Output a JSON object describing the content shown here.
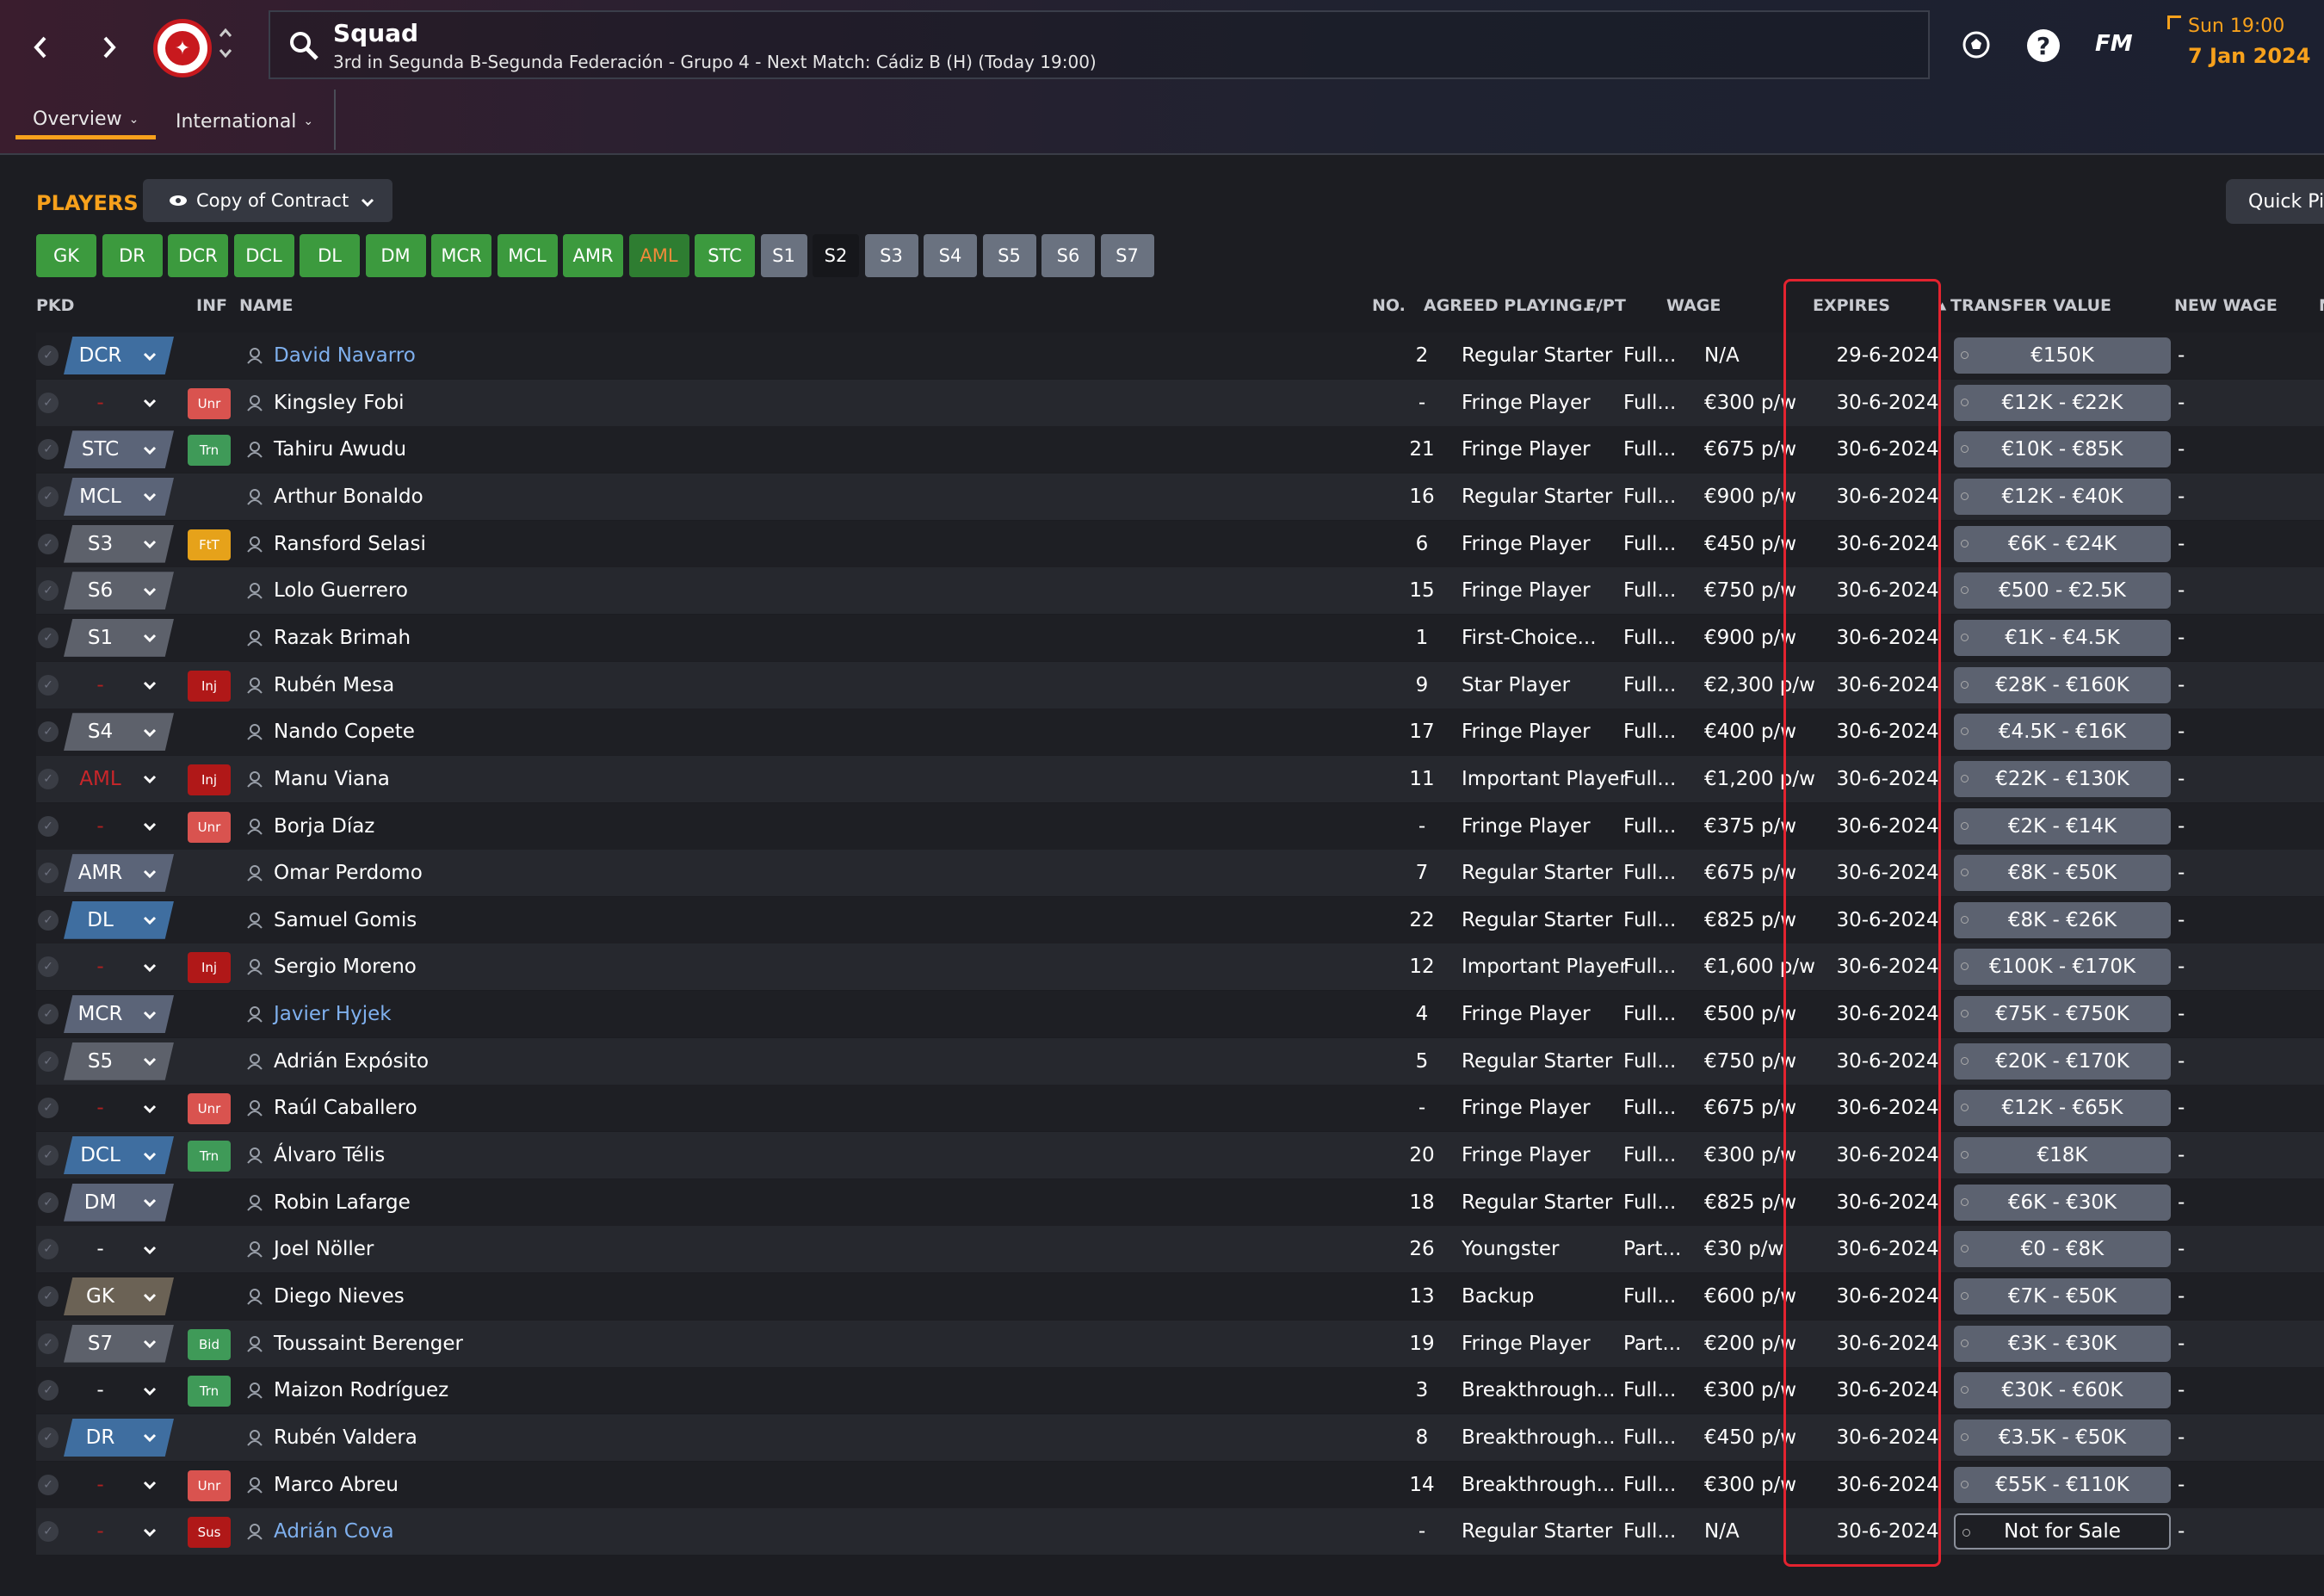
{
  "header": {
    "title": "Squad",
    "subtitle": "3rd in Segunda B-Segunda Federación - Grupo 4 - Next Match: Cádiz B (H) (Today 19:00)",
    "brand": "FM",
    "time": "Sun 19:00",
    "date": "7 Jan 2024",
    "help_symbol": "?"
  },
  "tabs": [
    {
      "label": "Overview",
      "active": true
    },
    {
      "label": "International",
      "active": false
    }
  ],
  "toolbar": {
    "section_label": "PLAYERS",
    "view_label": "Copy of Contract",
    "quick_pick_label": "Quick Pi"
  },
  "positions": [
    "GK",
    "DR",
    "DCR",
    "DCL",
    "DL",
    "DM",
    "MCR",
    "MCL",
    "AMR",
    "AML",
    "STC",
    "S1",
    "S2",
    "S3",
    "S4",
    "S5",
    "S6",
    "S7"
  ],
  "columns": {
    "pkd": "PKD",
    "inf": "INF",
    "name": "NAME",
    "no": "NO.",
    "agreed": "AGREED PLAYING...",
    "fpt": "F/PT",
    "wage": "WAGE",
    "expires": "EXPIRES",
    "transfer_value": "TRANSFER VALUE",
    "new_wage": "NEW WAGE",
    "extra": "N"
  },
  "colors": {
    "accent": "#f7a11c",
    "highlight_border": "#e3232f",
    "link": "#7fb0ee"
  },
  "players": [
    {
      "pos": "DCR",
      "inf": "",
      "name": "David Navarro",
      "no": "2",
      "agreed": "Regular Starter",
      "fpt": "Full...",
      "wage": "N/A",
      "expires": "29-6-2024",
      "tv": "€150K",
      "new_wage": "-"
    },
    {
      "pos": "-",
      "inf": "Unr",
      "name": "Kingsley Fobi",
      "no": "-",
      "agreed": "Fringe Player",
      "fpt": "Full...",
      "wage": "€300 p/w",
      "expires": "30-6-2024",
      "tv": "€12K - €22K",
      "new_wage": "-"
    },
    {
      "pos": "STC",
      "inf": "Trn",
      "name": "Tahiru Awudu",
      "no": "21",
      "agreed": "Fringe Player",
      "fpt": "Full...",
      "wage": "€675 p/w",
      "expires": "30-6-2024",
      "tv": "€10K - €85K",
      "new_wage": "-"
    },
    {
      "pos": "MCL",
      "inf": "",
      "name": "Arthur Bonaldo",
      "no": "16",
      "agreed": "Regular Starter",
      "fpt": "Full...",
      "wage": "€900 p/w",
      "expires": "30-6-2024",
      "tv": "€12K - €40K",
      "new_wage": "-"
    },
    {
      "pos": "S3",
      "inf": "FtT",
      "name": "Ransford Selasi",
      "no": "6",
      "agreed": "Fringe Player",
      "fpt": "Full...",
      "wage": "€450 p/w",
      "expires": "30-6-2024",
      "tv": "€6K - €24K",
      "new_wage": "-"
    },
    {
      "pos": "S6",
      "inf": "",
      "name": "Lolo Guerrero",
      "no": "15",
      "agreed": "Fringe Player",
      "fpt": "Full...",
      "wage": "€750 p/w",
      "expires": "30-6-2024",
      "tv": "€500 - €2.5K",
      "new_wage": "-"
    },
    {
      "pos": "S1",
      "inf": "",
      "name": "Razak Brimah",
      "no": "1",
      "agreed": "First-Choice...",
      "fpt": "Full...",
      "wage": "€900 p/w",
      "expires": "30-6-2024",
      "tv": "€1K - €4.5K",
      "new_wage": "-"
    },
    {
      "pos": "-",
      "inf": "Inj",
      "name": "Rubén Mesa",
      "no": "9",
      "agreed": "Star Player",
      "fpt": "Full...",
      "wage": "€2,300 p/w",
      "expires": "30-6-2024",
      "tv": "€28K - €160K",
      "new_wage": "-"
    },
    {
      "pos": "S4",
      "inf": "",
      "name": "Nando Copete",
      "no": "17",
      "agreed": "Fringe Player",
      "fpt": "Full...",
      "wage": "€400 p/w",
      "expires": "30-6-2024",
      "tv": "€4.5K - €16K",
      "new_wage": "-"
    },
    {
      "pos": "AML",
      "inf": "Inj",
      "name": "Manu Viana",
      "no": "11",
      "agreed": "Important Player",
      "fpt": "Full...",
      "wage": "€1,200 p/w",
      "expires": "30-6-2024",
      "tv": "€22K - €130K",
      "new_wage": "-"
    },
    {
      "pos": "-",
      "inf": "Unr",
      "name": "Borja Díaz",
      "no": "-",
      "agreed": "Fringe Player",
      "fpt": "Full...",
      "wage": "€375 p/w",
      "expires": "30-6-2024",
      "tv": "€2K - €14K",
      "new_wage": "-"
    },
    {
      "pos": "AMR",
      "inf": "",
      "name": "Omar Perdomo",
      "no": "7",
      "agreed": "Regular Starter",
      "fpt": "Full...",
      "wage": "€675 p/w",
      "expires": "30-6-2024",
      "tv": "€8K - €50K",
      "new_wage": "-"
    },
    {
      "pos": "DL",
      "inf": "",
      "name": "Samuel Gomis",
      "no": "22",
      "agreed": "Regular Starter",
      "fpt": "Full...",
      "wage": "€825 p/w",
      "expires": "30-6-2024",
      "tv": "€8K - €26K",
      "new_wage": "-"
    },
    {
      "pos": "-",
      "inf": "Inj",
      "name": "Sergio Moreno",
      "no": "12",
      "agreed": "Important Player",
      "fpt": "Full...",
      "wage": "€1,600 p/w",
      "expires": "30-6-2024",
      "tv": "€100K - €170K",
      "new_wage": "-"
    },
    {
      "pos": "MCR",
      "inf": "",
      "name": "Javier Hyjek",
      "no": "4",
      "agreed": "Fringe Player",
      "fpt": "Full...",
      "wage": "€500 p/w",
      "expires": "30-6-2024",
      "tv": "€75K - €750K",
      "new_wage": "-"
    },
    {
      "pos": "S5",
      "inf": "",
      "name": "Adrián Expósito",
      "no": "5",
      "agreed": "Regular Starter",
      "fpt": "Full...",
      "wage": "€750 p/w",
      "expires": "30-6-2024",
      "tv": "€20K - €170K",
      "new_wage": "-"
    },
    {
      "pos": "-",
      "inf": "Unr",
      "name": "Raúl Caballero",
      "no": "-",
      "agreed": "Fringe Player",
      "fpt": "Full...",
      "wage": "€675 p/w",
      "expires": "30-6-2024",
      "tv": "€12K - €65K",
      "new_wage": "-"
    },
    {
      "pos": "DCL",
      "inf": "Trn",
      "name": "Álvaro Télis",
      "no": "20",
      "agreed": "Fringe Player",
      "fpt": "Full...",
      "wage": "€300 p/w",
      "expires": "30-6-2024",
      "tv": "€18K",
      "new_wage": "-"
    },
    {
      "pos": "DM",
      "inf": "",
      "name": "Robin Lafarge",
      "no": "18",
      "agreed": "Regular Starter",
      "fpt": "Full...",
      "wage": "€825 p/w",
      "expires": "30-6-2024",
      "tv": "€6K - €30K",
      "new_wage": "-"
    },
    {
      "pos": "-",
      "inf": "",
      "name": "Joel Nöller",
      "no": "26",
      "agreed": "Youngster",
      "fpt": "Part...",
      "wage": "€30 p/w",
      "expires": "30-6-2024",
      "tv": "€0 - €8K",
      "new_wage": "-"
    },
    {
      "pos": "GK",
      "inf": "",
      "name": "Diego Nieves",
      "no": "13",
      "agreed": "Backup",
      "fpt": "Full...",
      "wage": "€600 p/w",
      "expires": "30-6-2024",
      "tv": "€7K - €50K",
      "new_wage": "-"
    },
    {
      "pos": "S7",
      "inf": "Bid",
      "name": "Toussaint Berenger",
      "no": "19",
      "agreed": "Fringe Player",
      "fpt": "Part...",
      "wage": "€200 p/w",
      "expires": "30-6-2024",
      "tv": "€3K - €30K",
      "new_wage": "-"
    },
    {
      "pos": "-",
      "inf": "Trn",
      "name": "Maizon Rodríguez",
      "no": "3",
      "agreed": "Breakthrough...",
      "fpt": "Full...",
      "wage": "€300 p/w",
      "expires": "30-6-2024",
      "tv": "€30K - €60K",
      "new_wage": "-"
    },
    {
      "pos": "DR",
      "inf": "",
      "name": "Rubén Valdera",
      "no": "8",
      "agreed": "Breakthrough...",
      "fpt": "Full...",
      "wage": "€450 p/w",
      "expires": "30-6-2024",
      "tv": "€3.5K - €50K",
      "new_wage": "-"
    },
    {
      "pos": "-",
      "inf": "Unr",
      "name": "Marco Abreu",
      "no": "14",
      "agreed": "Breakthrough...",
      "fpt": "Full...",
      "wage": "€300 p/w",
      "expires": "30-6-2024",
      "tv": "€55K - €110K",
      "new_wage": "-"
    },
    {
      "pos": "-",
      "inf": "Sus",
      "name": "Adrián Cova",
      "no": "-",
      "agreed": "Regular Starter",
      "fpt": "Full...",
      "wage": "N/A",
      "expires": "30-6-2024",
      "tv": "Not for Sale",
      "new_wage": "-"
    }
  ]
}
